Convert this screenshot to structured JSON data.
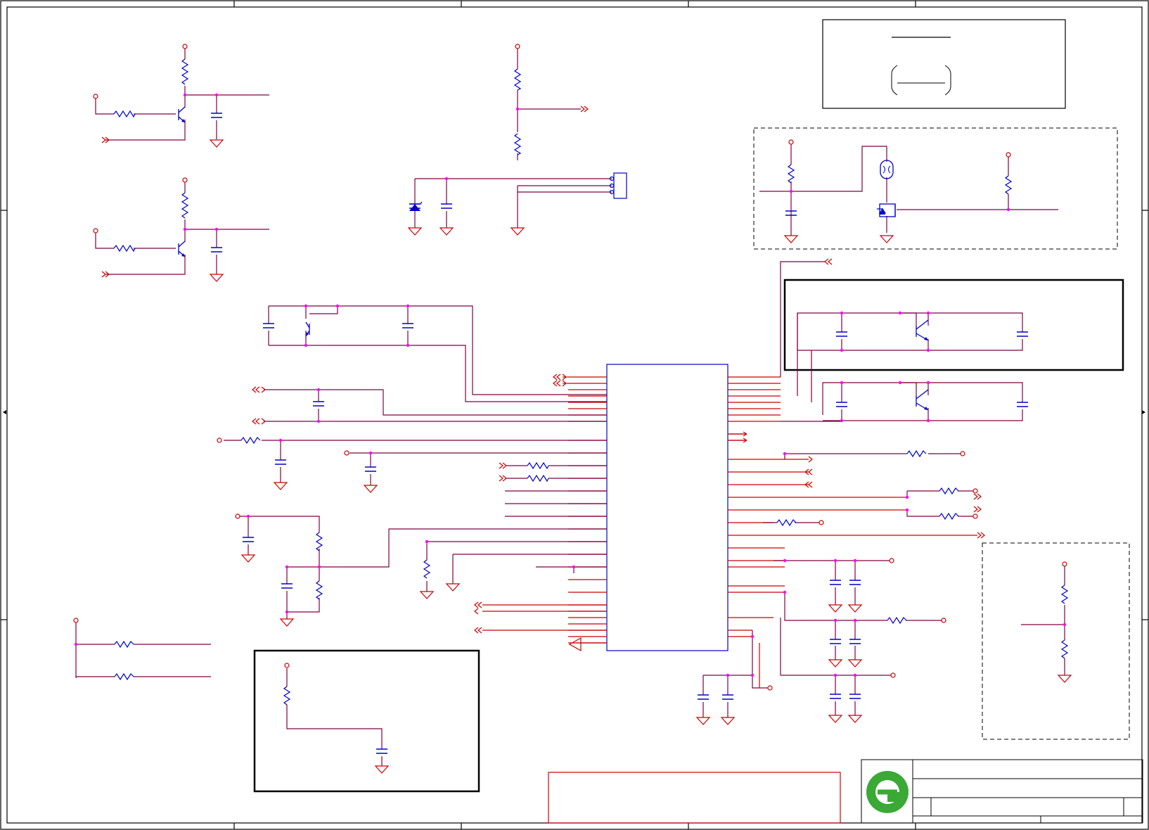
{
  "sheet": {
    "title": "",
    "notes": []
  },
  "palette": {
    "wire": "#cc0000",
    "net": "#800040",
    "component": "#0000cc",
    "junction": "#ff00ff",
    "frame": "#000000",
    "logo_green": "#3aa935"
  },
  "icons": {
    "logo": "company-logo-icon",
    "ground": "ground-symbol-icon",
    "resistor": "resistor-symbol-icon",
    "capacitor": "capacitor-symbol-icon",
    "transistor": "npn-transistor-icon",
    "diode": "zener-diode-icon",
    "crystal": "crystal-symbol-icon",
    "mosfet": "mosfet-symbol-icon",
    "connector": "connector-symbol-icon",
    "port": "offpage-port-icon"
  }
}
